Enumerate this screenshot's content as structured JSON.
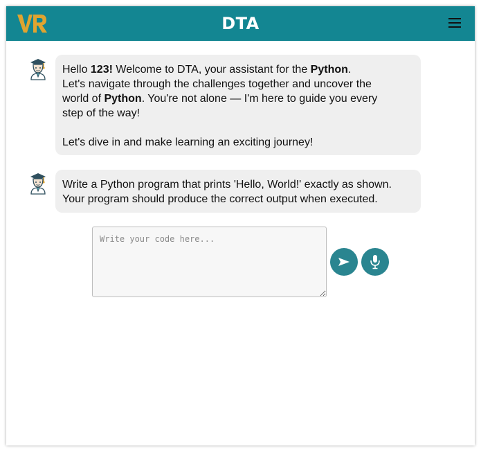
{
  "header": {
    "logo_text": "VR",
    "title": "DTA",
    "menu_icon": "hamburger-menu-icon",
    "background_color": "#138692",
    "logo_color": "#e0a430"
  },
  "messages": [
    {
      "avatar_icon": "graduate-student-icon",
      "segments": [
        {
          "text": "Hello "
        },
        {
          "text": "123!",
          "bold": true
        },
        {
          "text": " Welcome to DTA, your assistant for the "
        },
        {
          "text": "Python",
          "bold": true
        },
        {
          "text": "."
        }
      ],
      "line2": "Let's navigate through the challenges together and uncover the",
      "line3_pre": "world of ",
      "line3_bold": "Python",
      "line3_post": ". You're not alone — I'm here to guide you every",
      "line4": "step of the way!",
      "line5": "Let's dive in and make learning an exciting journey!"
    },
    {
      "avatar_icon": "graduate-student-icon",
      "line1": "Write a Python program that prints 'Hello, World!' exactly as shown.",
      "line2": "Your program should produce the correct output when executed."
    }
  ],
  "composer": {
    "placeholder": "Write your code here...",
    "value": "",
    "send_icon": "send-arrow-icon",
    "mic_icon": "microphone-icon",
    "button_color": "#2a8590"
  },
  "bubble_color": "#efefef"
}
